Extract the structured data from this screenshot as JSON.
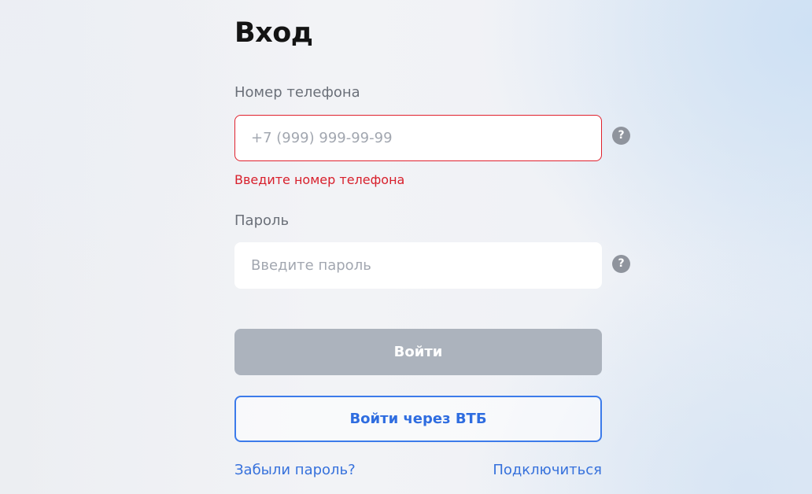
{
  "page": {
    "title": "Вход"
  },
  "phone": {
    "label": "Номер телефона",
    "placeholder": "+7 (999) 999-99-99",
    "value": "",
    "error": "Введите номер телефона",
    "help_icon": "question-icon",
    "help_glyph": "?"
  },
  "password": {
    "label": "Пароль",
    "placeholder": "Введите пароль",
    "value": "",
    "help_icon": "question-icon",
    "help_glyph": "?"
  },
  "actions": {
    "login_label": "Войти",
    "vtb_login_label": "Войти через ВТБ"
  },
  "links": {
    "forgot_password": "Забыли пароль?",
    "connect": "Подключиться"
  },
  "colors": {
    "error": "#e0212d",
    "accent": "#3c7bea",
    "disabled_button": "#acb3bd"
  }
}
